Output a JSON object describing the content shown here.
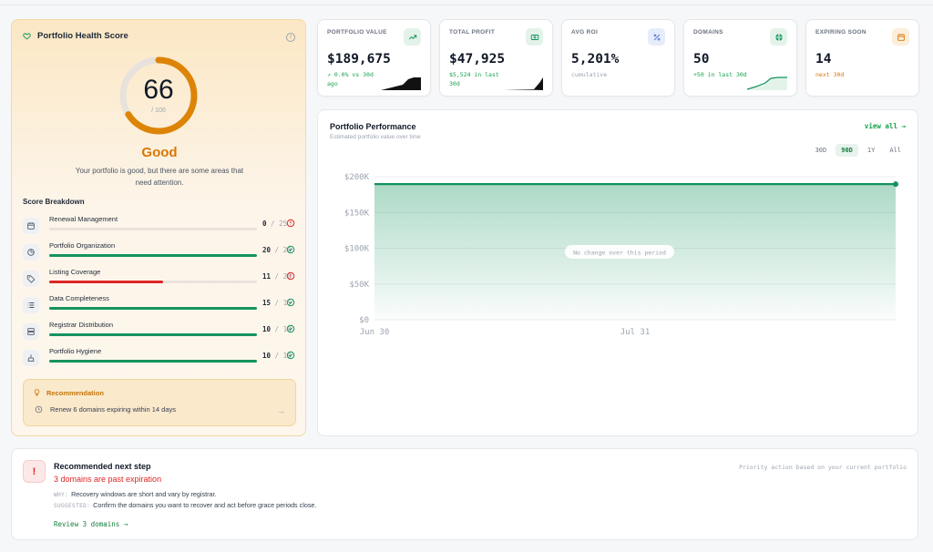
{
  "health": {
    "title": "Portfolio Health Score",
    "score": "66",
    "score_max": "/ 100",
    "score_value": 66,
    "grade": "Good",
    "description": "Your portfolio is good, but there are some areas that need attention.",
    "breakdown_title": "Score Breakdown",
    "items": [
      {
        "label": "Renewal Management",
        "score": "0",
        "max": "25",
        "fraction": 0.0,
        "icon": "calendar-icon",
        "status": "warning"
      },
      {
        "label": "Portfolio Organization",
        "score": "20",
        "max": "20",
        "fraction": 1.0,
        "icon": "pie-chart-icon",
        "status": "ok"
      },
      {
        "label": "Listing Coverage",
        "score": "11",
        "max": "20",
        "fraction": 0.55,
        "icon": "tag-icon",
        "status": "warning"
      },
      {
        "label": "Data Completeness",
        "score": "15",
        "max": "15",
        "fraction": 1.0,
        "icon": "list-icon",
        "status": "ok"
      },
      {
        "label": "Registrar Distribution",
        "score": "10",
        "max": "10",
        "fraction": 1.0,
        "icon": "server-icon",
        "status": "ok"
      },
      {
        "label": "Portfolio Hygiene",
        "score": "10",
        "max": "10",
        "fraction": 1.0,
        "icon": "broom-icon",
        "status": "ok"
      }
    ],
    "recommendation": {
      "title": "Recommendation",
      "text": "Renew 6 domains expiring within 14 days"
    }
  },
  "kpis": [
    {
      "label": "PORTFOLIO VALUE",
      "value": "$189,675",
      "sub": "0.0% vs 30d ago",
      "icon": "trend-up-icon"
    },
    {
      "label": "TOTAL PROFIT",
      "value": "$47,925",
      "sub": "$5,524 in last 30d",
      "icon": "money-icon"
    },
    {
      "label": "AVG ROI",
      "value": "5,201%",
      "sub": "cumulative",
      "icon": "percent-icon"
    },
    {
      "label": "DOMAINS",
      "value": "50",
      "sub": "+50 in last 30d",
      "icon": "globe-icon"
    },
    {
      "label": "EXPIRING SOON",
      "value": "14",
      "sub": "next 30d",
      "icon": "calendar-alert-icon"
    }
  ],
  "performance": {
    "title": "Portfolio Performance",
    "subtitle": "Estimated portfolio value over time",
    "view_all": "view all →",
    "ranges": [
      "30D",
      "90D",
      "1Y",
      "All"
    ],
    "active_range": "90D",
    "empty_note": "No change over this period"
  },
  "chart_data": {
    "type": "area",
    "x": [
      "Jun 30",
      "Jul 31"
    ],
    "x_ticks": [
      "Jun 30",
      "Jul 31"
    ],
    "y_ticks": [
      "$0",
      "$50K",
      "$100K",
      "$150K",
      "$200K"
    ],
    "ylim": [
      0,
      200000
    ],
    "series": [
      {
        "values": [
          189675,
          189675
        ]
      }
    ],
    "grid": true,
    "color": "#15935e"
  },
  "next_step": {
    "title": "Recommended next step",
    "headline": "3 domains are past expiration",
    "why_label": "WHY:",
    "why": "Recovery windows are short and vary by registrar.",
    "suggested_label": "SUGGESTED:",
    "suggested": "Confirm the domains you want to recover and act before grace periods close.",
    "link": "Review 3 domains →",
    "hint": "Priority action based on your current portfolio"
  },
  "colors": {
    "accent_green": "#15935e",
    "warning_amber": "#d97706",
    "danger_red": "#dc2626"
  }
}
